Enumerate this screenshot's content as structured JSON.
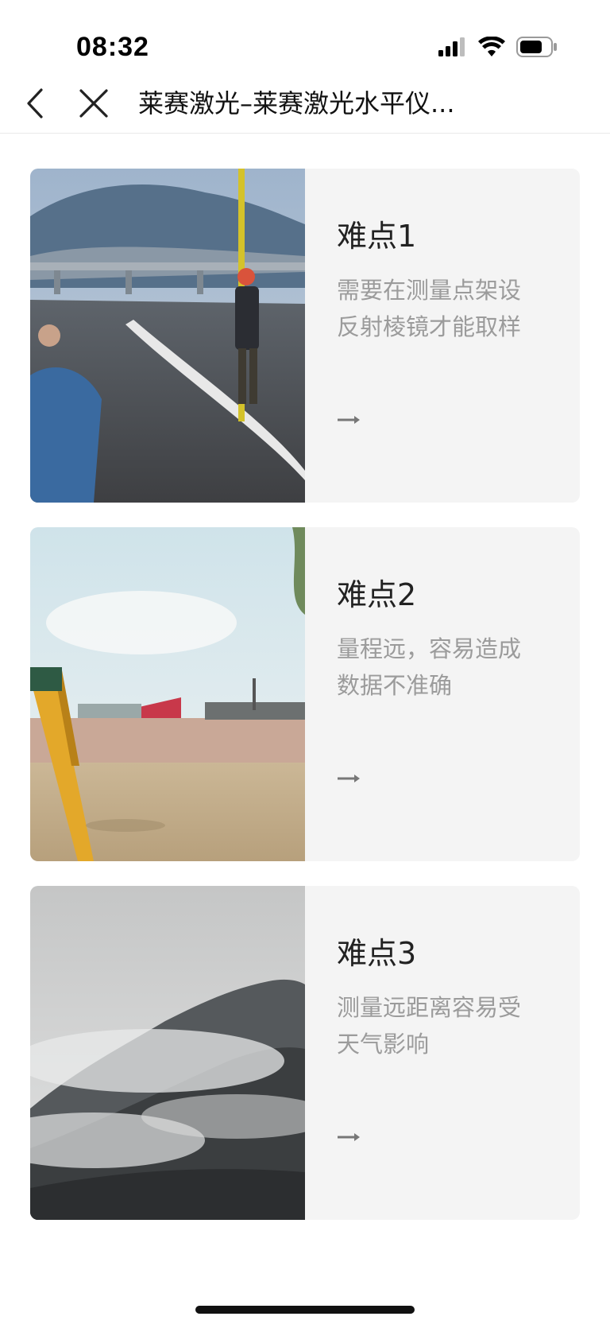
{
  "status": {
    "time": "08:32"
  },
  "nav": {
    "title": "莱赛激光–莱赛激光水平仪..."
  },
  "cards": [
    {
      "title": "难点1",
      "desc": "需要在测量点架设反射棱镜才能取样"
    },
    {
      "title": "难点2",
      "desc": "量程远，容易造成数据不准确"
    },
    {
      "title": "难点3",
      "desc": "测量远距离容易受天气影响"
    }
  ],
  "colors": {
    "card_bg": "#f4f4f4",
    "desc_text": "#9b9b9b",
    "title_text": "#222222"
  }
}
